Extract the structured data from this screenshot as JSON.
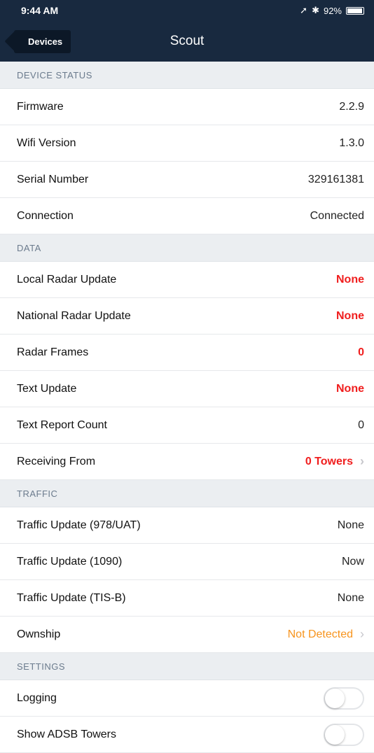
{
  "status": {
    "time": "9:44 AM",
    "battery": "92%"
  },
  "nav": {
    "back_label": "Devices",
    "title": "Scout"
  },
  "sections": {
    "device_status": {
      "header": "DEVICE STATUS",
      "rows": [
        {
          "label": "Firmware",
          "value": "2.2.9"
        },
        {
          "label": "Wifi Version",
          "value": "1.3.0"
        },
        {
          "label": "Serial Number",
          "value": "329161381"
        },
        {
          "label": "Connection",
          "value": "Connected"
        }
      ]
    },
    "data": {
      "header": "DATA",
      "rows": [
        {
          "label": "Local Radar Update",
          "value": "None"
        },
        {
          "label": "National Radar Update",
          "value": "None"
        },
        {
          "label": "Radar Frames",
          "value": "0"
        },
        {
          "label": "Text Update",
          "value": "None"
        },
        {
          "label": "Text Report Count",
          "value": "0"
        },
        {
          "label": "Receiving From",
          "value": "0 Towers"
        }
      ]
    },
    "traffic": {
      "header": "TRAFFIC",
      "rows": [
        {
          "label": "Traffic Update (978/UAT)",
          "value": "None"
        },
        {
          "label": "Traffic Update (1090)",
          "value": "Now"
        },
        {
          "label": "Traffic Update (TIS-B)",
          "value": "None"
        },
        {
          "label": "Ownship",
          "value": "Not Detected"
        }
      ]
    },
    "settings": {
      "header": "SETTINGS",
      "rows": [
        {
          "label": "Logging",
          "on": false
        },
        {
          "label": "Show ADSB Towers",
          "on": false
        }
      ]
    }
  },
  "colors": {
    "nav_bg": "#18293f",
    "alert": "#f01e1e",
    "warning": "#f7941d"
  }
}
